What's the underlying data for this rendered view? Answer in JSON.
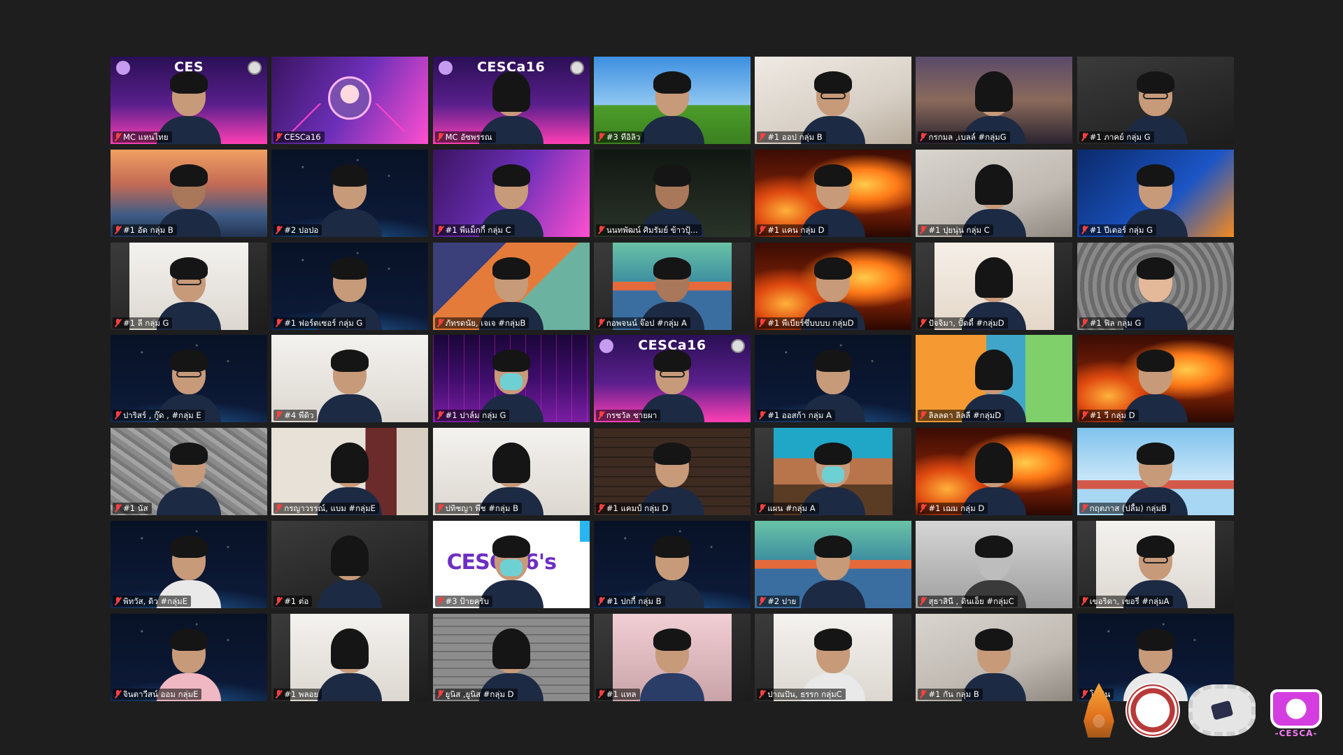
{
  "meeting": {
    "active_speaker_index": 24
  },
  "participants": [
    {
      "name": "MC แหนไทย",
      "bg": "purple",
      "banner": "CES",
      "avatar": "normal"
    },
    {
      "name": "CESCa16",
      "bg": "pink",
      "avatar": "logo"
    },
    {
      "name": "MC อัซพรรณ",
      "bg": "purple",
      "banner": "CESCa16",
      "avatar": "longhair"
    },
    {
      "name": "#3 ทีอิลิว",
      "bg": "sky",
      "avatar": "normal"
    },
    {
      "name": "#1 ออป กลุ่ม B",
      "bg": "room2",
      "avatar": "glasses"
    },
    {
      "name": "กรกมล ,เบลล์ #กลุ่มG",
      "bg": "crowd",
      "avatar": "longhair"
    },
    {
      "name": "#1 ภาคย์ กลุ่ม G",
      "bg": "dark",
      "avatar": "glasses"
    },
    {
      "name": "#1 อัด กลุ่ม B",
      "bg": "bridge",
      "avatar": "dark"
    },
    {
      "name": "#2 ปอปอ",
      "bg": "space",
      "avatar": "normal"
    },
    {
      "name": "#1 พี่แม็กกี้ กลุ่ม C",
      "bg": "pink",
      "avatar": "normal"
    },
    {
      "name": "นนทพัฒน์ ศิมรัมย์ ข้าวปุ้...",
      "bg": "nightgreen",
      "avatar": "dark"
    },
    {
      "name": "#1 แคน กลุ่ม D",
      "bg": "fire",
      "avatar": "normal"
    },
    {
      "name": "#1 ปุยนุ่น กลุ่ม C",
      "bg": "room",
      "avatar": "longhair"
    },
    {
      "name": "#1 ปีเตอร์ กลุ่ม G",
      "bg": "stock",
      "avatar": "normal"
    },
    {
      "name": "#1 ลี กลุ่ม G",
      "bg": "white",
      "avatar": "glasses",
      "inset": true
    },
    {
      "name": "#1 ฟอร์ตเซอร์ กลุ่ม G",
      "bg": "space",
      "avatar": "normal"
    },
    {
      "name": "ภัทรดนัย, เจเจ #กลุ่มB",
      "bg": "orange",
      "avatar": "normal"
    },
    {
      "name": "กอพจนน์ จ๊อป #กลุ่ม A",
      "bg": "underwater",
      "avatar": "dark",
      "inset": true
    },
    {
      "name": "#1 พีเบียร์ซึ่บบบบ กลุ่มD",
      "bg": "fire",
      "avatar": "normal"
    },
    {
      "name": "ปัจจิมา, ปั้ดดี้ #กลุ่มD",
      "bg": "bright",
      "avatar": "longhair",
      "inset": true
    },
    {
      "name": "#1 ฟิล กลุ่ม G",
      "bg": "tunnel",
      "avatar": "light"
    },
    {
      "name": "ปาริสร์ , กู๊ด , #กลุ่ม E",
      "bg": "space",
      "avatar": "glasses"
    },
    {
      "name": "#4 พี่ดิว",
      "bg": "white",
      "avatar": "normal"
    },
    {
      "name": "#1 ปาล์ม กลุ่ม G",
      "bg": "retro",
      "avatar": "mask"
    },
    {
      "name": "กรชวัล ชายผา",
      "bg": "purple",
      "banner": "CESCa16",
      "avatar": "glasses"
    },
    {
      "name": "#1 ออสก้า กลุ่ม A",
      "bg": "space",
      "avatar": "normal"
    },
    {
      "name": "ลิลลดา ลิลลี่ #กลุ่มD",
      "bg": "sponge",
      "avatar": "longhair"
    },
    {
      "name": "#1 วี กลุ่ม D",
      "bg": "fire",
      "avatar": "normal"
    },
    {
      "name": "#1 นัส",
      "bg": "rock",
      "avatar": "normal"
    },
    {
      "name": "กรญาวรรณ์, แบม #กลุ่มE",
      "bg": "curtain",
      "avatar": "longhair"
    },
    {
      "name": "ปทิชญา พีช #กลุ่ม B",
      "bg": "white",
      "avatar": "longhair"
    },
    {
      "name": "#1 แคมป์ กลุ่ม D",
      "bg": "brick",
      "avatar": "normal"
    },
    {
      "name": "แผน #กลุ่ม A",
      "bg": "wood",
      "avatar": "mask",
      "inset": true
    },
    {
      "name": "#1 เฌม กลุ่ม D",
      "bg": "fire",
      "avatar": "longhair"
    },
    {
      "name": "กฤตภาส (ปลื้ม) กลุ่มB",
      "bg": "cloudy",
      "avatar": "normal"
    },
    {
      "name": "พิทวัส, ดิว #กลุ่มE",
      "bg": "space",
      "avatar": "white"
    },
    {
      "name": "#1 ต่อ",
      "bg": "dark",
      "avatar": "longhair"
    },
    {
      "name": "#3 ป้ายครับ",
      "bg": "cesc",
      "avatar": "mask"
    },
    {
      "name": "#1 ปกกี้ กลุ่ม B",
      "bg": "space",
      "avatar": "normal"
    },
    {
      "name": "#2 ปาย",
      "bg": "underwater",
      "avatar": "normal"
    },
    {
      "name": "สุธาสินี , ดินเอ็ย #กลุ่มC",
      "bg": "grey",
      "avatar": "bw"
    },
    {
      "name": "เขอริดา, เขอรี่ #กลุ่มA",
      "bg": "white",
      "avatar": "glasses",
      "inset": true
    },
    {
      "name": "จินตาวีสน์ ออม กลุ่มE",
      "bg": "space",
      "avatar": "pink"
    },
    {
      "name": "#1 พลอย",
      "bg": "white",
      "avatar": "longhair",
      "inset": true
    },
    {
      "name": "ยูนิส ,ยูนิส #กลุ่ม D",
      "bg": "brickwall",
      "avatar": "longhair"
    },
    {
      "name": "#1 แทล",
      "bg": "pinkroom",
      "avatar": "navy",
      "inset": true
    },
    {
      "name": "ปาณปัน, ธรรก กลุ่มC",
      "bg": "white",
      "avatar": "white",
      "inset": true
    },
    {
      "name": "#1 กัน กลุ่ม B",
      "bg": "room",
      "avatar": "normal"
    },
    {
      "name": "โภคิน",
      "bg": "space",
      "avatar": "white"
    }
  ],
  "cesc_card": {
    "title": "CESC 16's"
  },
  "logos": {
    "cesca_text": "-CESCA-"
  }
}
